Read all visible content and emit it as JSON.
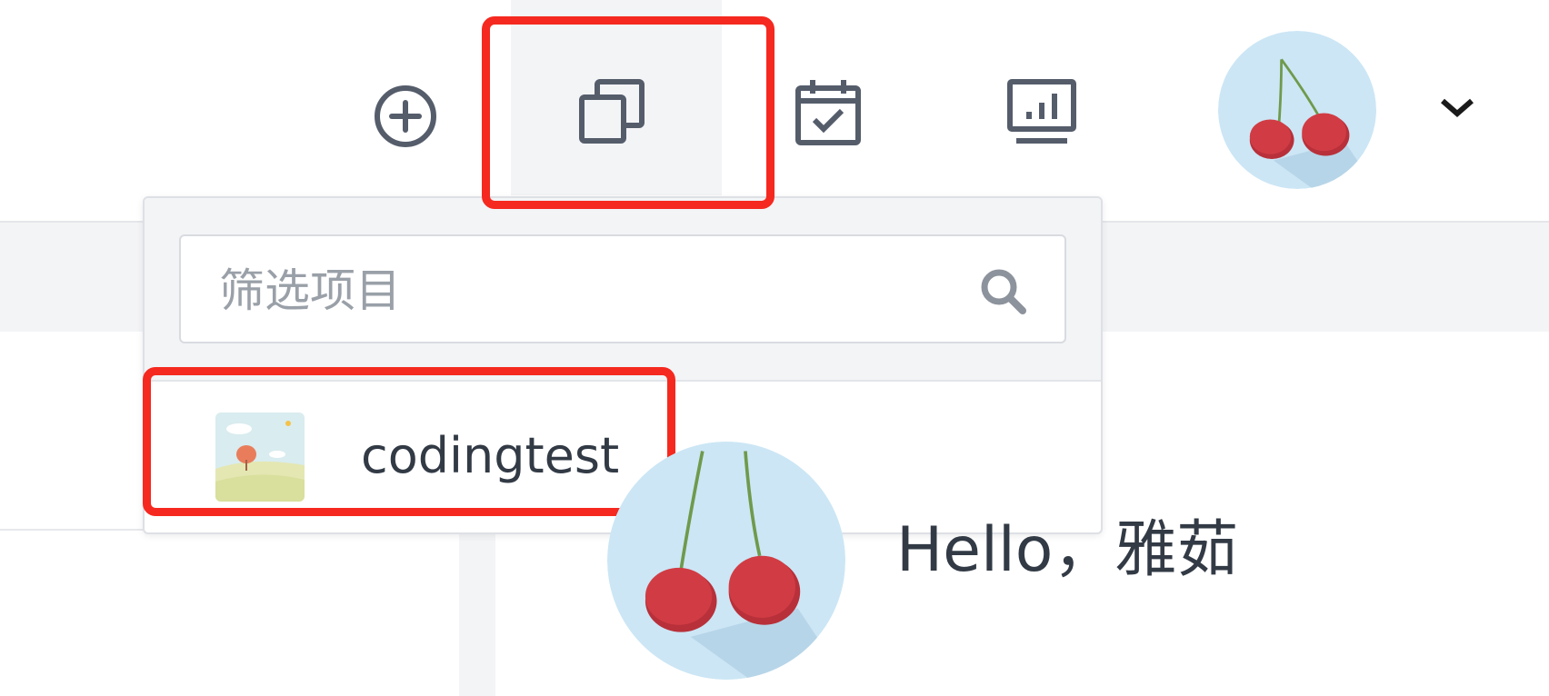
{
  "header": {
    "add_button": {
      "icon": "plus-circle-icon"
    },
    "projects_button": {
      "icon": "copy-stack-icon",
      "highlighted": true
    },
    "calendar_button": {
      "icon": "calendar-check-icon"
    },
    "board_button": {
      "icon": "presentation-board-icon"
    },
    "user_menu": {
      "avatar": "cherry-avatar",
      "chevron": "chevron-down-icon"
    }
  },
  "project_dropdown": {
    "search": {
      "placeholder": "筛选项目",
      "value": "",
      "icon": "search-icon"
    },
    "projects": [
      {
        "name": "codingtest",
        "thumbnail": "landscape-tree-thumbnail",
        "highlighted": true
      }
    ]
  },
  "welcome": {
    "greeting": "Hello，雅茹",
    "avatar": "cherry-avatar"
  },
  "colors": {
    "icon": "#555d6b",
    "highlight_border": "#f5291f",
    "panel_background": "#f3f4f6",
    "avatar_background": "#cce6f5",
    "cherry": "#d13c44",
    "text": "#323a45"
  }
}
